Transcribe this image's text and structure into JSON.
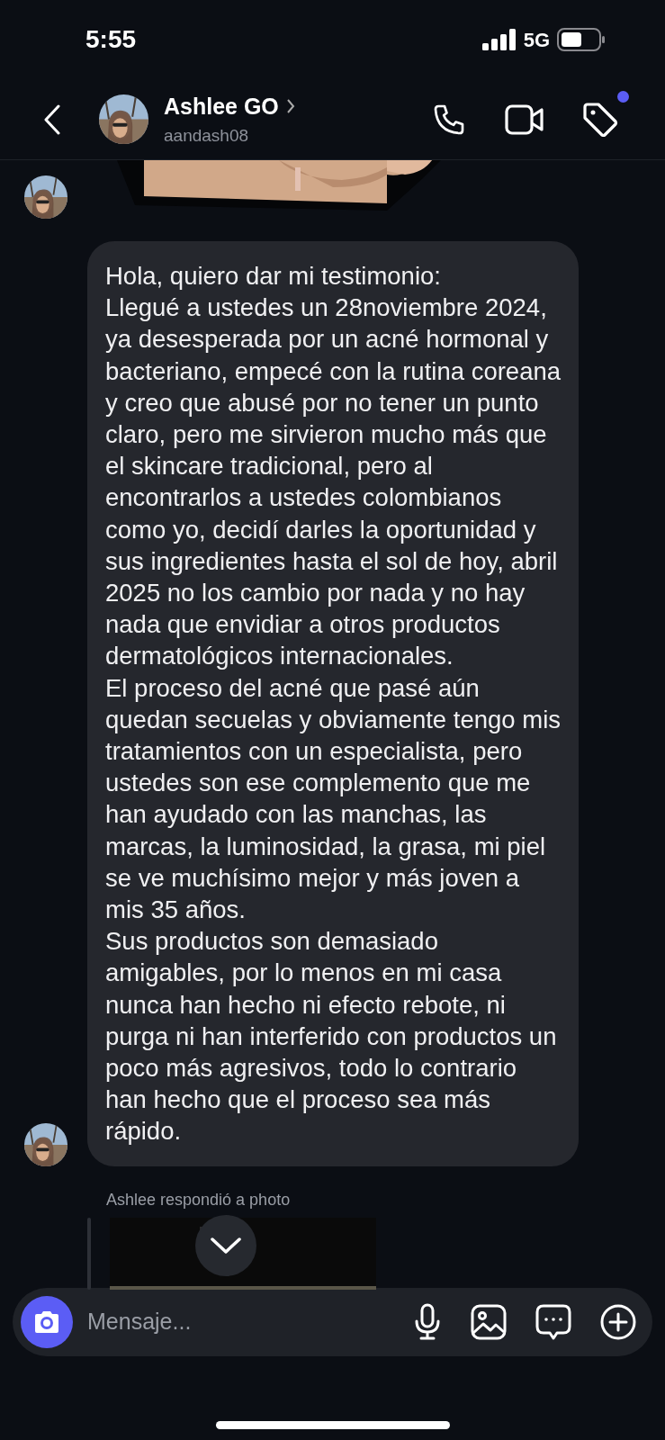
{
  "status_bar": {
    "time": "5:55",
    "network": "5G"
  },
  "header": {
    "name": "Ashlee GO",
    "username": "aandash08",
    "labels_unread": true
  },
  "message": {
    "paragraphs": [
      "Hola, quiero dar mi testimonio:",
      "Llegué a ustedes un 28noviembre 2024, ya desesperada por un acné hormonal y bacteriano, empecé con la rutina coreana y creo que abusé por no tener un punto claro, pero me sirvieron mucho más que el skincare tradicional, pero al encontrarlos a ustedes colombianos como yo, decidí darles la oportunidad y sus ingredientes hasta el sol de hoy, abril 2025 no los cambio por nada y no hay nada que envidiar a otros productos dermatológicos internacionales.",
      "El proceso del acné que pasé aún quedan secuelas y obviamente tengo mis tratamientos con un especialista, pero ustedes son ese complemento que me han ayudado con las manchas, las marcas, la luminosidad, la grasa, mi piel se ve muchísimo mejor y más joven a mis 35 años.",
      "Sus productos son demasiado amigables, por lo menos en mi casa nunca han hecho ni efecto rebote, ni purga ni han interferido con productos un poco más agresivos, todo lo contrario han hecho que el proceso sea más rápido."
    ]
  },
  "reply": {
    "label": "Ashlee respondió a photo"
  },
  "composer": {
    "placeholder": "Mensaje..."
  }
}
